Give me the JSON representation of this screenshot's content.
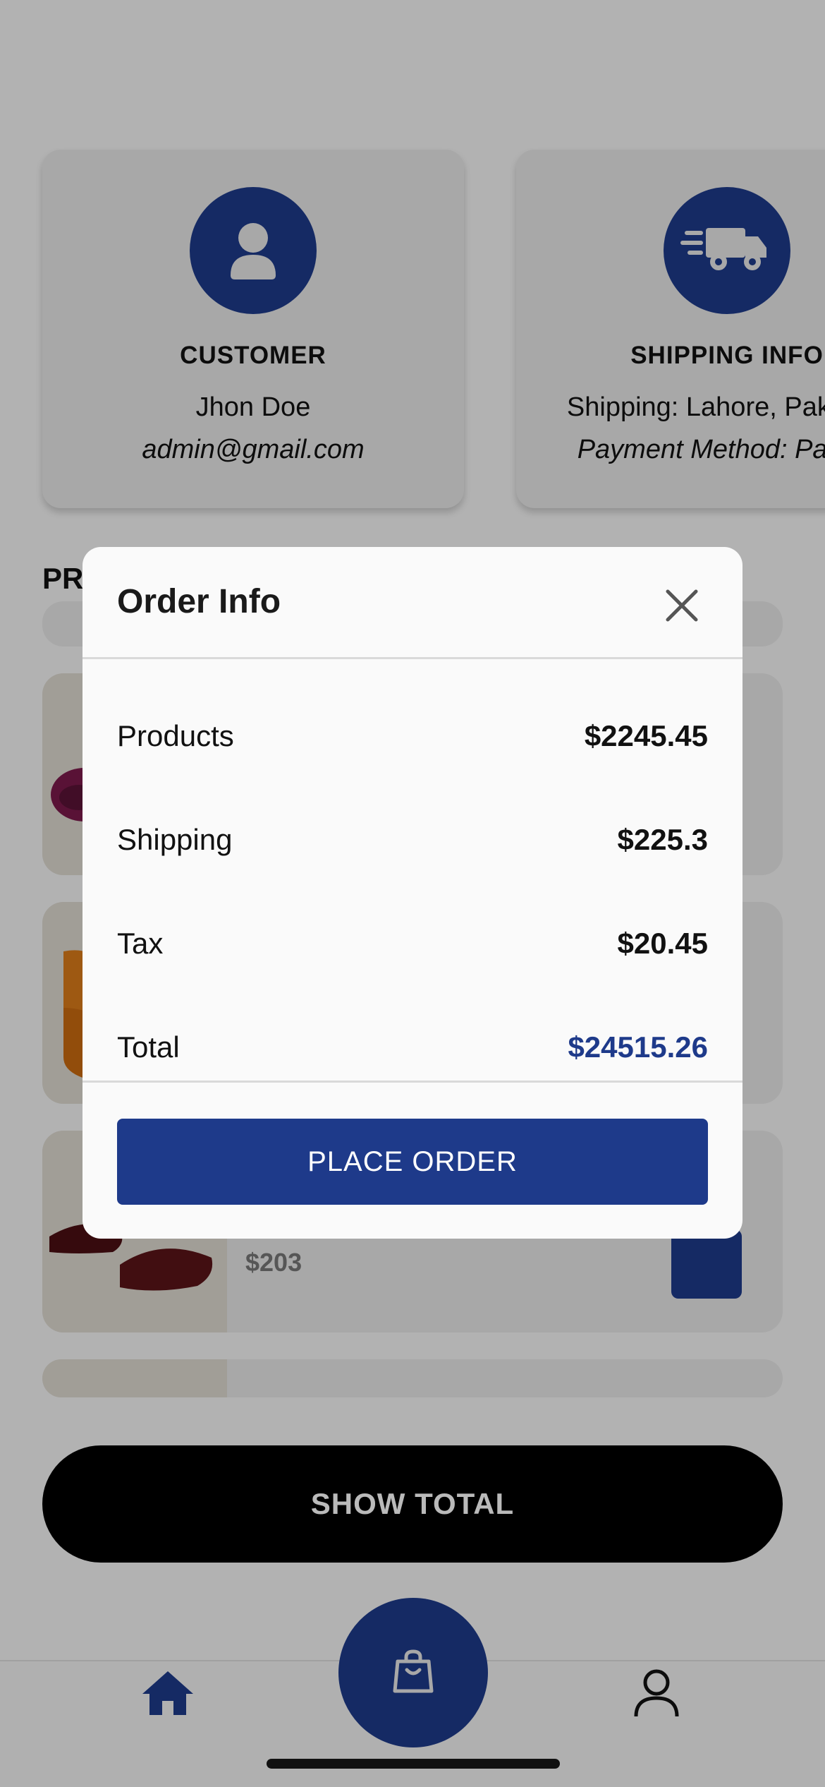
{
  "colors": {
    "accent": "#1e3a8a",
    "background": "#f4f4f4",
    "card": "#e6e6e6"
  },
  "customer_card": {
    "heading": "CUSTOMER",
    "name": "Jhon Doe",
    "email": "admin@gmail.com",
    "icon": "person-icon"
  },
  "shipping_card": {
    "heading": "SHIPPING INFO",
    "shipping": "Shipping: Lahore, Pakistan",
    "payment": "Payment Method: Paypal",
    "icon": "truck-icon"
  },
  "products_section": {
    "heading": "PRODUCTS"
  },
  "products": [
    {
      "price": "$203"
    }
  ],
  "show_total_label": "SHOW TOTAL",
  "modal": {
    "title": "Order Info",
    "rows": [
      {
        "label": "Products",
        "value": "$2245.45"
      },
      {
        "label": "Shipping",
        "value": "$225.3"
      },
      {
        "label": "Tax",
        "value": "$20.45"
      },
      {
        "label": "Total",
        "value": "$24515.26"
      }
    ],
    "place_order_label": "PLACE ORDER"
  },
  "bottom_nav": {
    "items": [
      "home-icon",
      "shopping-bag-icon",
      "profile-icon"
    ]
  }
}
